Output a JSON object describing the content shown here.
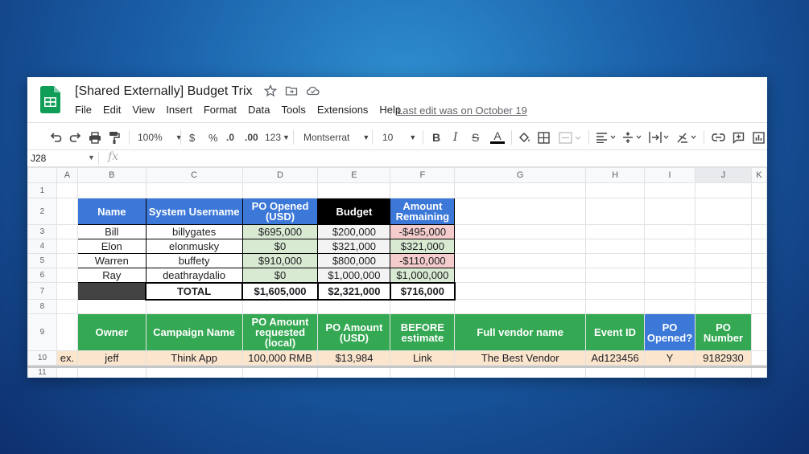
{
  "window": {
    "title": "[Shared Externally] Budget Trix",
    "last_edit": "Last edit was on October 19"
  },
  "menu": [
    "File",
    "Edit",
    "View",
    "Insert",
    "Format",
    "Data",
    "Tools",
    "Extensions",
    "Help"
  ],
  "toolbar": {
    "zoom": "100%",
    "currency": "$",
    "percent": "%",
    "decimal_decrease": ".0",
    "decimal_increase": ".00",
    "number_format": "123",
    "font": "Montserrat",
    "font_size": "10",
    "bold": "B",
    "italic": "I",
    "strike": "S",
    "text_color": "A"
  },
  "formula_bar": {
    "cell_ref": "J28",
    "fx": "fx"
  },
  "columns": [
    "A",
    "B",
    "C",
    "D",
    "E",
    "F",
    "G",
    "H",
    "I",
    "J",
    "K"
  ],
  "rows": [
    "1",
    "2",
    "3",
    "4",
    "5",
    "6",
    "7",
    "8",
    "9",
    "10",
    "11"
  ],
  "table1": {
    "headers": [
      "Name",
      "System Username",
      "PO Opened (USD)",
      "Budget",
      "Amount Remaining"
    ],
    "rows": [
      [
        "Bill",
        "billygates",
        "$695,000",
        "$200,000",
        "-$495,000"
      ],
      [
        "Elon",
        "elonmusky",
        "$0",
        "$321,000",
        "$321,000"
      ],
      [
        "Warren",
        "buffety",
        "$910,000",
        "$800,000",
        "-$110,000"
      ],
      [
        "Ray",
        "deathraydalio",
        "$0",
        "$1,000,000",
        "$1,000,000"
      ]
    ],
    "total": [
      "TOTAL",
      "$1,605,000",
      "$2,321,000",
      "$716,000"
    ]
  },
  "table2": {
    "headers": [
      "Owner",
      "Campaign Name",
      "PO Amount requested (local)",
      "PO Amount (USD)",
      "BEFORE estimate",
      "Full vendor name",
      "Event ID",
      "PO Opened?",
      "PO Number"
    ],
    "example": [
      "ex.",
      "jeff",
      "Think App",
      "100,000 RMB",
      "$13,984",
      "Link",
      "The Best Vendor",
      "Ad123456",
      "Y",
      "9182930"
    ]
  },
  "colors": {
    "header_blue": "#3c78d8",
    "header_green": "#34a853",
    "positive_green": "#d9ead3",
    "negative_red": "#f4cccc",
    "example_row": "#fce5cd"
  }
}
